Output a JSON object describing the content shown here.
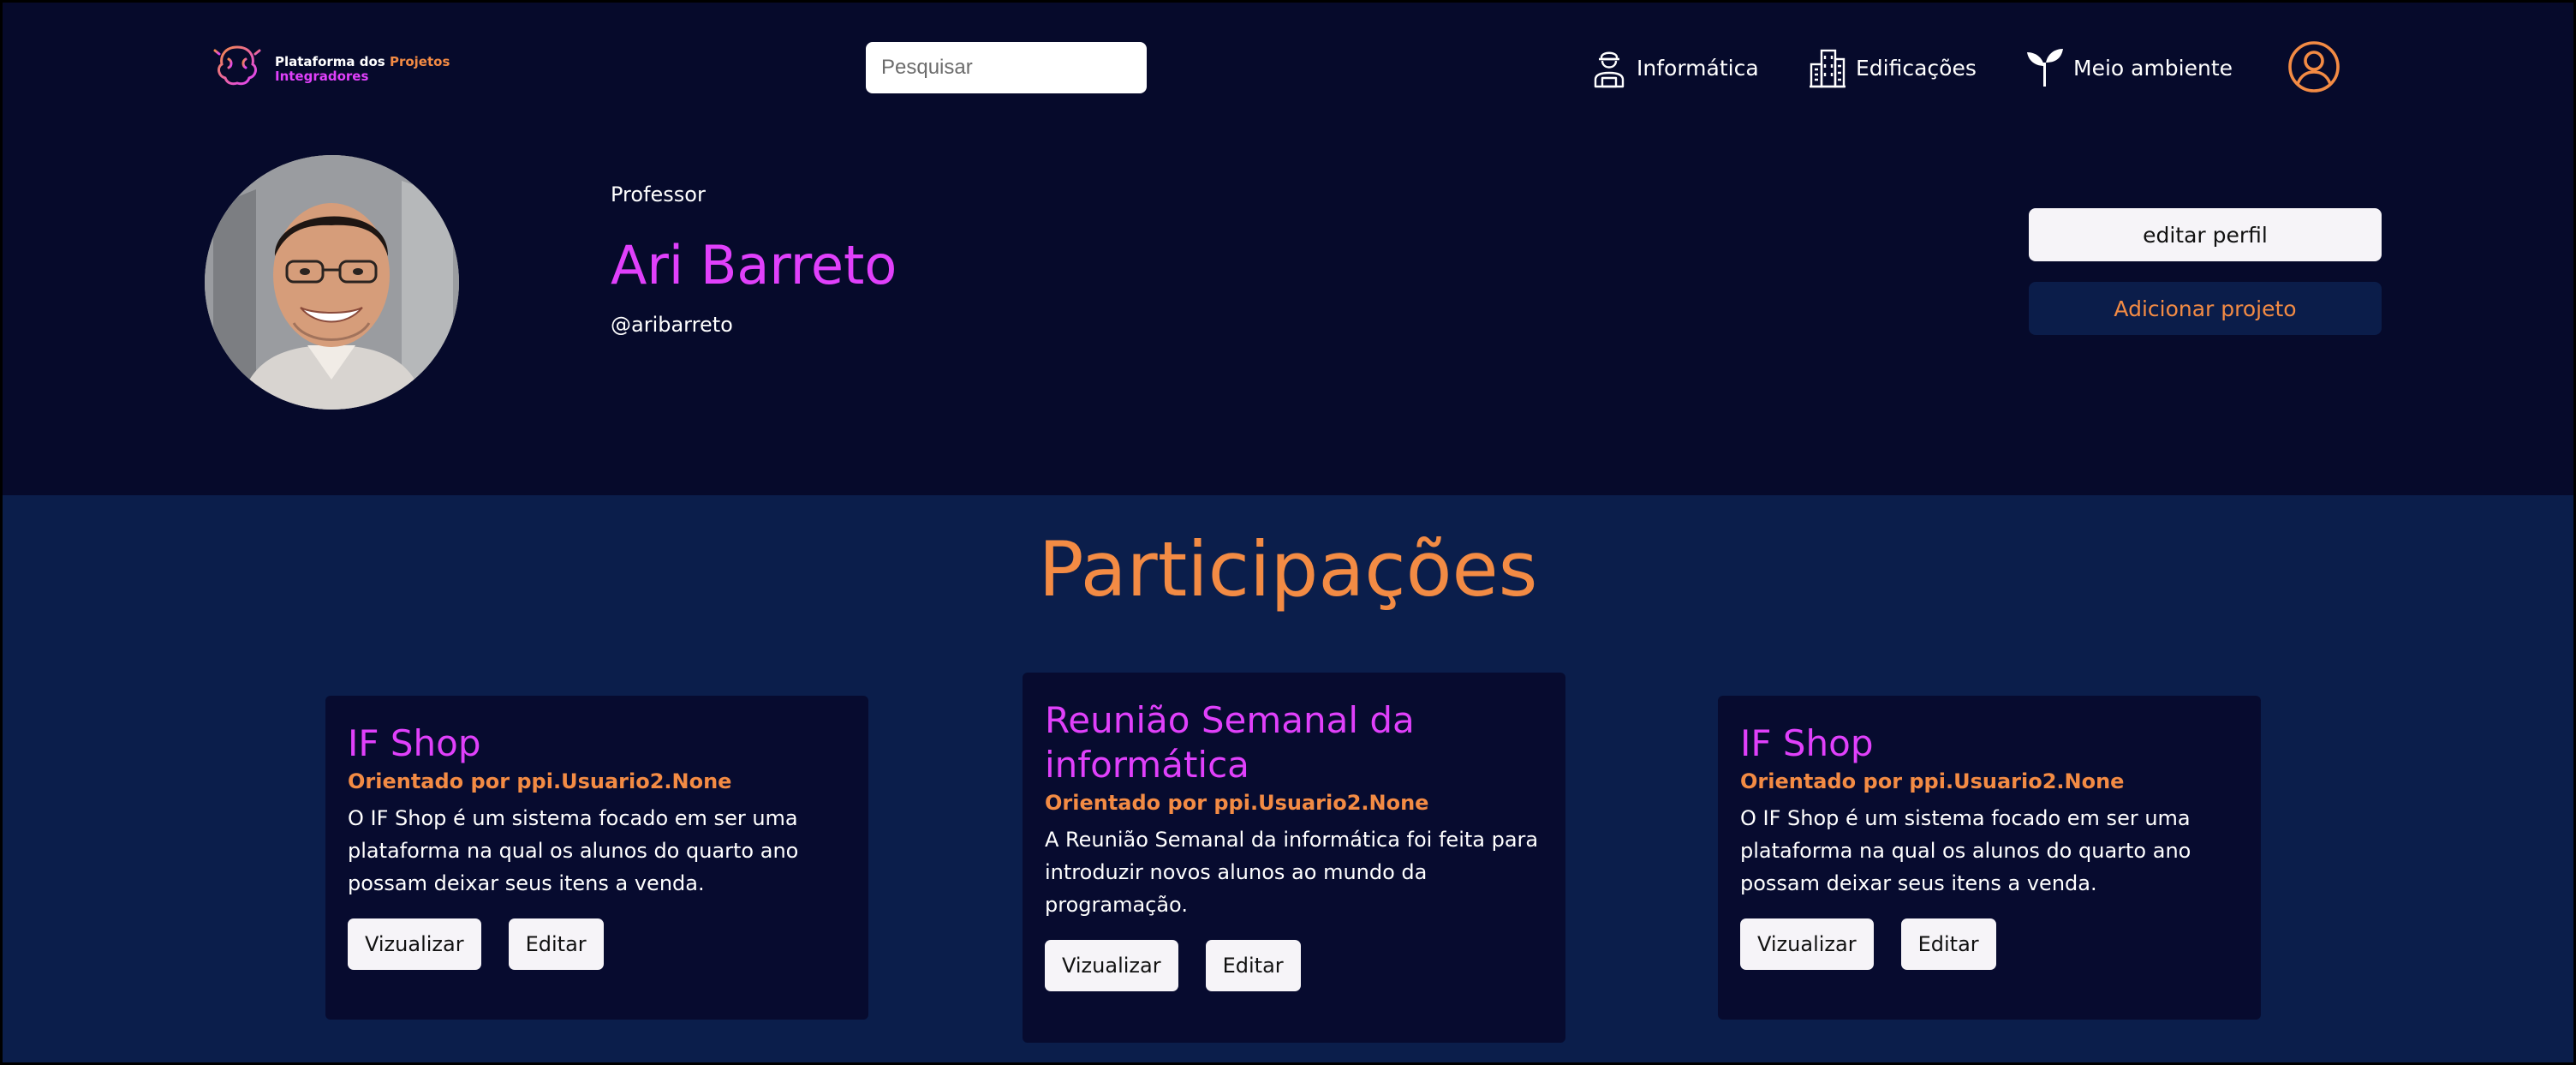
{
  "navbar": {
    "logo": {
      "line1_white": "Plataforma dos ",
      "line1_orange": "Projetos",
      "line2": "Integradores"
    },
    "search": {
      "placeholder": "Pesquisar",
      "value": ""
    },
    "links": [
      {
        "label": "Informática",
        "icon": "technician-icon"
      },
      {
        "label": "Edificações",
        "icon": "buildings-icon"
      },
      {
        "label": "Meio ambiente",
        "icon": "sprout-icon"
      }
    ],
    "user_icon": "user-circle-icon"
  },
  "profile": {
    "role": "Professor",
    "name": "Ari Barreto",
    "handle": "@aribarreto",
    "edit_profile_label": "editar perfil",
    "add_project_label": "Adicionar projeto"
  },
  "participations": {
    "title": "Participações",
    "cards": [
      {
        "title": "IF Shop",
        "advisor": "Orientado por ppi.Usuario2.None",
        "description": "O IF Shop é um sistema focado em ser uma plataforma na qual os alunos do quarto ano possam deixar seus itens a venda.",
        "view_label": "Vizualizar",
        "edit_label": "Editar"
      },
      {
        "title": "Reunião Semanal da informática",
        "advisor": "Orientado por ppi.Usuario2.None",
        "description": "A Reunião Semanal da informática foi feita para introduzir novos alunos ao mundo da programação.",
        "view_label": "Vizualizar",
        "edit_label": "Editar"
      },
      {
        "title": "IF Shop",
        "advisor": "Orientado por ppi.Usuario2.None",
        "description": "O IF Shop é um sistema focado em ser uma plataforma na qual os alunos do quarto ano possam deixar seus itens a venda.",
        "view_label": "Vizualizar",
        "edit_label": "Editar"
      }
    ]
  },
  "colors": {
    "header_bg": "#060a2b",
    "section_bg": "#0b1e4b",
    "card_bg": "#070b2f",
    "accent_pink": "#e040fb",
    "accent_orange": "#f38b44"
  }
}
